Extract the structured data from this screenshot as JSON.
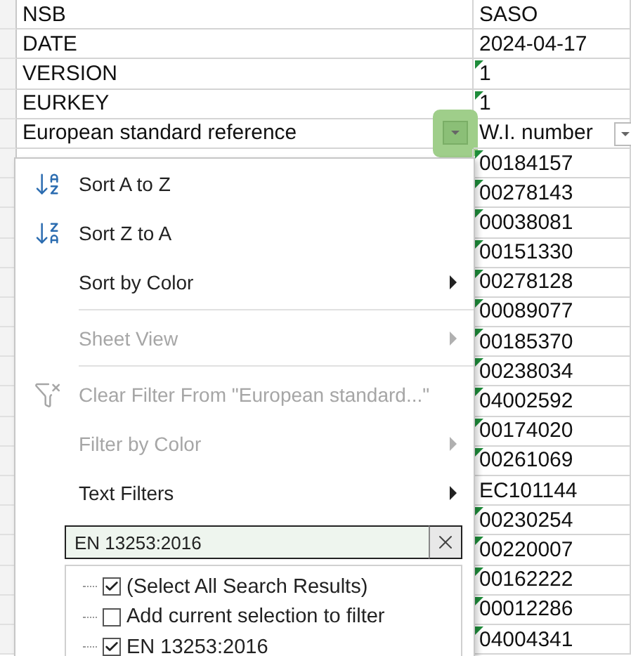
{
  "sheet": {
    "rows": [
      {
        "label": "NSB",
        "value": "SASO",
        "flag": false
      },
      {
        "label": "DATE",
        "value": "2024-04-17",
        "flag": false
      },
      {
        "label": "VERSION",
        "value": "1",
        "flag": true
      },
      {
        "label": "EURKEY",
        "value": "1",
        "flag": true
      }
    ],
    "header": {
      "column_a": "European standard reference",
      "column_b": "W.I. number",
      "filter_active": true
    },
    "values": [
      {
        "value": "00184157",
        "flag": true
      },
      {
        "value": "00278143",
        "flag": true
      },
      {
        "value": "00038081",
        "flag": true
      },
      {
        "value": "00151330",
        "flag": true
      },
      {
        "value": "00278128",
        "flag": true
      },
      {
        "value": "00089077",
        "flag": true
      },
      {
        "value": "00185370",
        "flag": true
      },
      {
        "value": "00238034",
        "flag": true
      },
      {
        "value": "04002592",
        "flag": true
      },
      {
        "value": "00174020",
        "flag": true
      },
      {
        "value": "00261069",
        "flag": true
      },
      {
        "value": "EC101144",
        "flag": false
      },
      {
        "value": "00230254",
        "flag": true
      },
      {
        "value": "00220007",
        "flag": true
      },
      {
        "value": "00162222",
        "flag": true
      },
      {
        "value": "00012286",
        "flag": true
      },
      {
        "value": "04004341",
        "flag": true
      }
    ]
  },
  "menu": {
    "items": [
      {
        "kind": "sort_ascending",
        "label": "Sort A to Z",
        "disabled": false,
        "submenu": false
      },
      {
        "kind": "sort_descending",
        "label": "Sort Z to A",
        "disabled": false,
        "submenu": false
      },
      {
        "kind": "plain",
        "label": "Sort by Color",
        "disabled": false,
        "submenu": true
      },
      {
        "kind": "separator"
      },
      {
        "kind": "plain",
        "label": "Sheet View",
        "disabled": true,
        "submenu": true
      },
      {
        "kind": "separator"
      },
      {
        "kind": "clear_filter",
        "label": "Clear Filter From \"European standard...\"",
        "disabled": true,
        "submenu": false
      },
      {
        "kind": "plain",
        "label": "Filter by Color",
        "disabled": true,
        "submenu": true
      },
      {
        "kind": "plain",
        "label": "Text Filters",
        "disabled": false,
        "submenu": true
      }
    ],
    "search": {
      "value": "EN 13253:2016"
    },
    "options": [
      {
        "label": "(Select All Search Results)",
        "checked": true
      },
      {
        "label": "Add current selection to filter",
        "checked": false
      },
      {
        "label": "EN 13253:2016",
        "checked": true
      }
    ]
  }
}
